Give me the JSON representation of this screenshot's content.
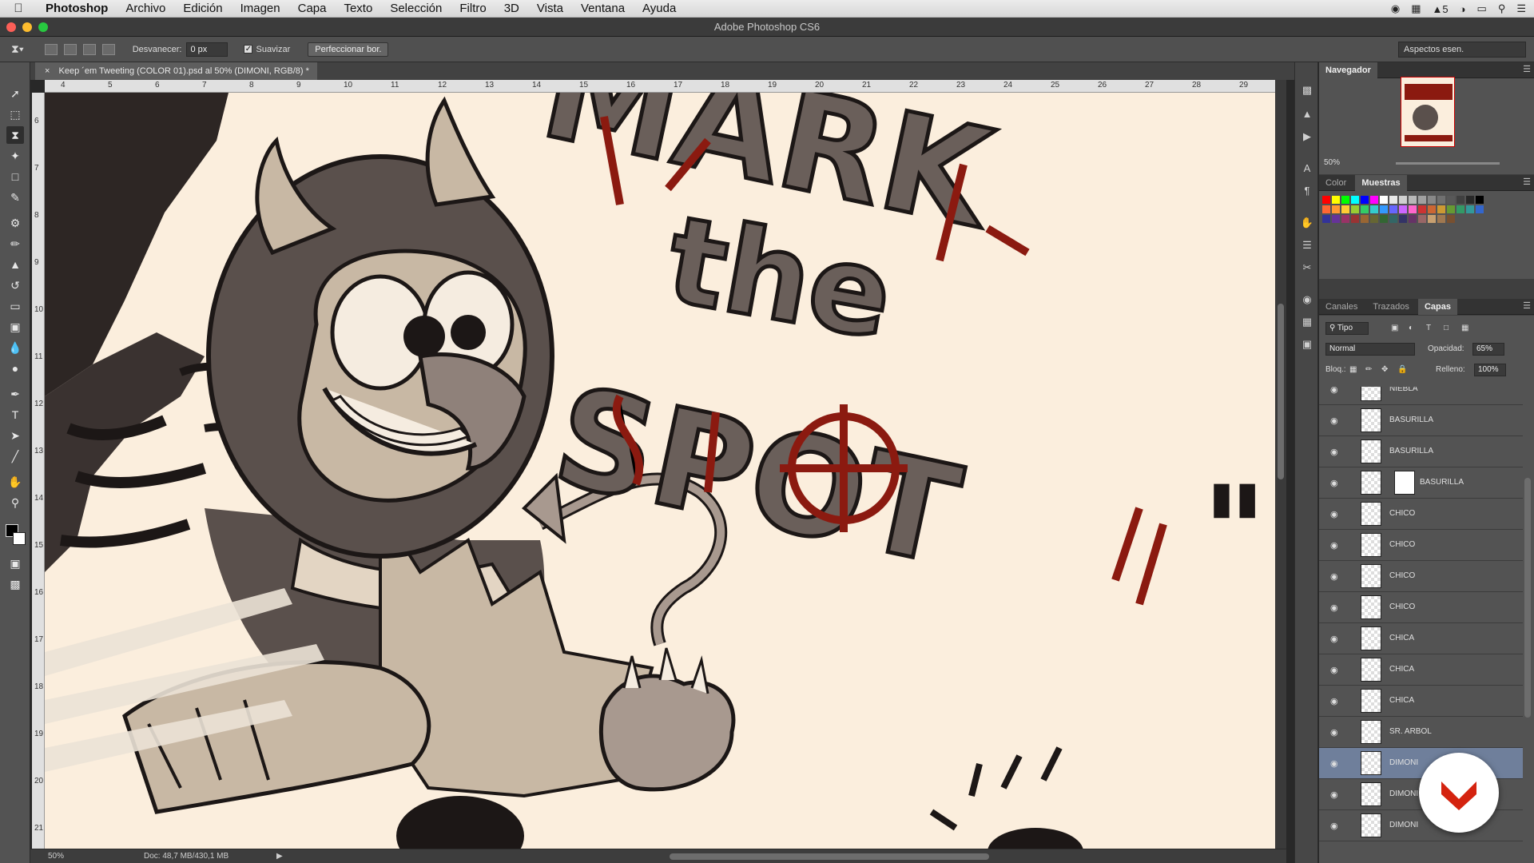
{
  "menubar": {
    "app": "Photoshop",
    "items": [
      "Archivo",
      "Edición",
      "Imagen",
      "Capa",
      "Texto",
      "Selección",
      "Filtro",
      "3D",
      "Vista",
      "Ventana",
      "Ayuda"
    ],
    "status_text": "5"
  },
  "window": {
    "title": "Adobe Photoshop CS6"
  },
  "options": {
    "feather_label": "Desvanecer:",
    "feather_value": "0 px",
    "smooth_label": "Suavizar",
    "refine_button": "Perfeccionar bor.",
    "workspace": "Aspectos esen."
  },
  "document": {
    "tab_title": "Keep ´em Tweeting (COLOR 01).psd al 50% (DIMONI, RGB/8) *",
    "artwork_text": {
      "line1": "MARK",
      "line2": "the",
      "line3": "SPOT",
      "quote": "\""
    }
  },
  "ruler": {
    "h_ticks": [
      "4",
      "5",
      "6",
      "7",
      "8",
      "9",
      "10",
      "11",
      "12",
      "13",
      "14",
      "15",
      "16",
      "17",
      "18",
      "19",
      "20",
      "21",
      "22",
      "23",
      "24",
      "25",
      "26",
      "27",
      "28",
      "29"
    ],
    "v_ticks": [
      "6",
      "7",
      "8",
      "9",
      "10",
      "11",
      "12",
      "13",
      "14",
      "15",
      "16",
      "17",
      "18",
      "19",
      "20",
      "21"
    ]
  },
  "status": {
    "zoom": "50%",
    "doc_size": "Doc: 48,7 MB/430,1 MB"
  },
  "navigator": {
    "tab": "Navegador",
    "zoom": "50%"
  },
  "swatches_panel": {
    "tabs": [
      "Color",
      "Muestras"
    ],
    "active": "Muestras",
    "colors": [
      "#ff0000",
      "#ffff00",
      "#00ff00",
      "#00ffff",
      "#0000ff",
      "#ff00ff",
      "#ffffff",
      "#e8e8e8",
      "#d0d0d0",
      "#b8b8b8",
      "#a0a0a0",
      "#888888",
      "#707070",
      "#585858",
      "#404040",
      "#282828",
      "#000000",
      "#ff6633",
      "#ff9933",
      "#ffcc33",
      "#99cc33",
      "#33cc66",
      "#33cccc",
      "#3399ff",
      "#6666ff",
      "#cc66ff",
      "#ff66cc",
      "#cc3333",
      "#cc6633",
      "#cc9933",
      "#669933",
      "#339966",
      "#339999",
      "#3366cc",
      "#333399",
      "#663399",
      "#993366",
      "#993333",
      "#996633",
      "#666633",
      "#336633",
      "#336666",
      "#333366",
      "#663366",
      "#996666",
      "#c8a070",
      "#a07850",
      "#785030"
    ]
  },
  "layers_panel": {
    "tabs": [
      "Canales",
      "Trazados",
      "Capas"
    ],
    "active": "Capas",
    "filter_label": "Tipo",
    "blend_mode": "Normal",
    "opacity_label": "Opacidad:",
    "opacity": "65%",
    "lock_label": "Bloq.:",
    "fill_label": "Relleno:",
    "fill": "100%",
    "layers": [
      {
        "name": "NIEBLA",
        "selected": false
      },
      {
        "name": "BASURILLA",
        "selected": false
      },
      {
        "name": "BASURILLA",
        "selected": false
      },
      {
        "name": "BASURILLA",
        "selected": false,
        "mask": true
      },
      {
        "name": "CHICO",
        "selected": false
      },
      {
        "name": "CHICO",
        "selected": false
      },
      {
        "name": "CHICO",
        "selected": false
      },
      {
        "name": "CHICO",
        "selected": false
      },
      {
        "name": "CHICA",
        "selected": false
      },
      {
        "name": "CHICA",
        "selected": false
      },
      {
        "name": "CHICA",
        "selected": false
      },
      {
        "name": "SR. ARBOL",
        "selected": false
      },
      {
        "name": "DIMONI",
        "selected": true
      },
      {
        "name": "DIMONI",
        "selected": false
      },
      {
        "name": "DIMONI",
        "selected": false
      }
    ]
  },
  "colors": {
    "accent_red": "#8b1a10",
    "ink_gray": "#5a504c",
    "paper": "#fbeedd",
    "badge_red": "#d4230f"
  }
}
